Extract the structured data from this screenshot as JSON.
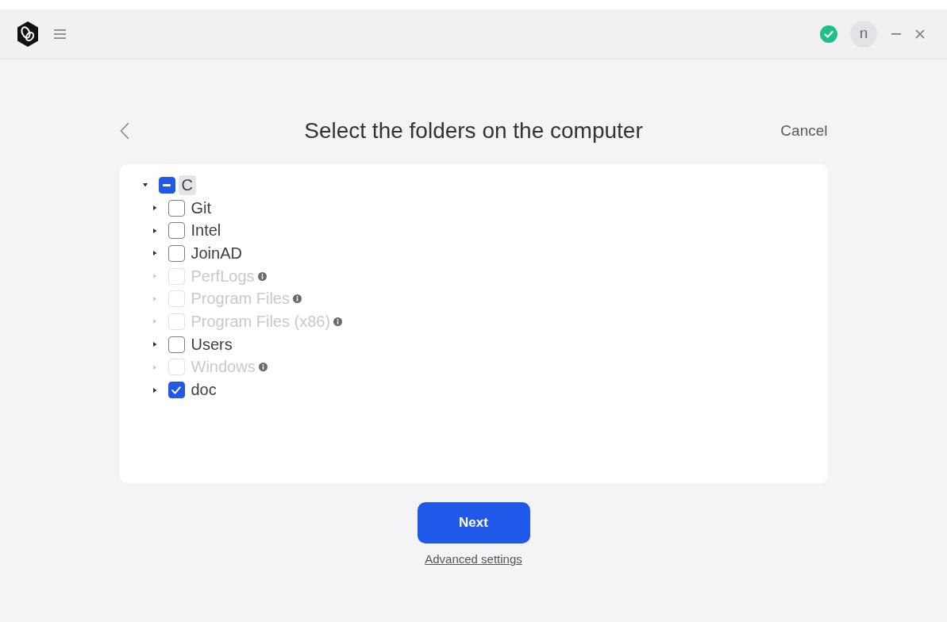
{
  "title_bar": {
    "avatar_initial": "n"
  },
  "header": {
    "title": "Select the folders on the computer",
    "cancel": "Cancel"
  },
  "tree": [
    {
      "label": "C",
      "checked": false,
      "partial": true,
      "expanded": true,
      "selected": true,
      "disabled": false,
      "info": false,
      "children": [
        {
          "label": "Git",
          "checked": false,
          "partial": false,
          "expanded": false,
          "selected": false,
          "disabled": false,
          "info": false
        },
        {
          "label": "Intel",
          "checked": false,
          "partial": false,
          "expanded": false,
          "selected": false,
          "disabled": false,
          "info": false
        },
        {
          "label": "JoinAD",
          "checked": false,
          "partial": false,
          "expanded": false,
          "selected": false,
          "disabled": false,
          "info": false
        },
        {
          "label": "PerfLogs",
          "checked": false,
          "partial": false,
          "expanded": false,
          "selected": false,
          "disabled": true,
          "info": true
        },
        {
          "label": "Program Files",
          "checked": false,
          "partial": false,
          "expanded": false,
          "selected": false,
          "disabled": true,
          "info": true
        },
        {
          "label": "Program Files (x86)",
          "checked": false,
          "partial": false,
          "expanded": false,
          "selected": false,
          "disabled": true,
          "info": true
        },
        {
          "label": "Users",
          "checked": false,
          "partial": false,
          "expanded": false,
          "selected": false,
          "disabled": false,
          "info": false
        },
        {
          "label": "Windows",
          "checked": false,
          "partial": false,
          "expanded": false,
          "selected": false,
          "disabled": true,
          "info": true
        },
        {
          "label": "doc",
          "checked": true,
          "partial": false,
          "expanded": false,
          "selected": false,
          "disabled": false,
          "info": false
        }
      ]
    }
  ],
  "footer": {
    "next": "Next",
    "advanced_settings": "Advanced settings"
  }
}
